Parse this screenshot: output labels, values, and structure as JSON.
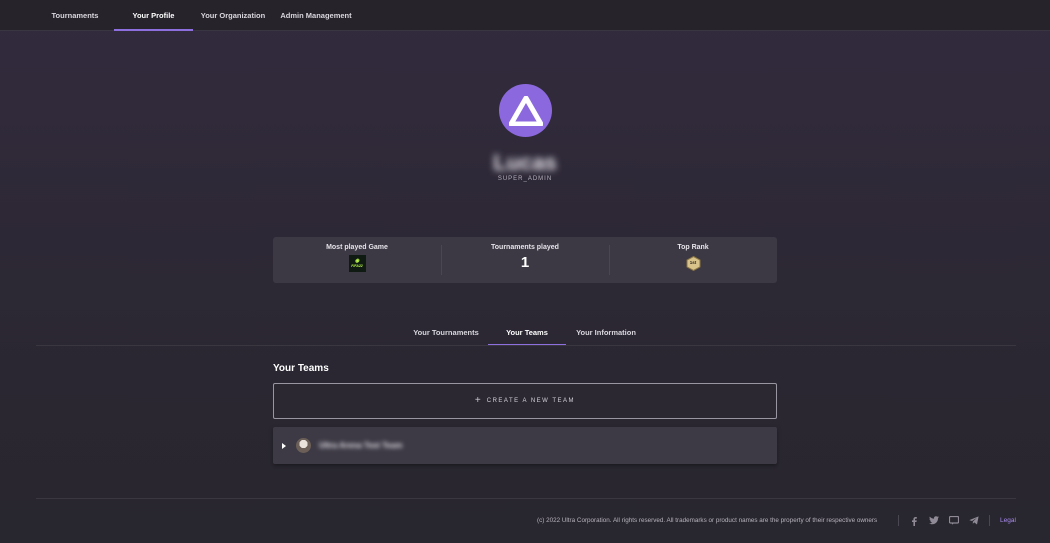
{
  "nav": {
    "items": [
      {
        "label": "Tournaments",
        "active": false
      },
      {
        "label": "Your Profile",
        "active": true
      },
      {
        "label": "Your Organization",
        "active": false
      },
      {
        "label": "Admin Management",
        "active": false
      }
    ]
  },
  "profile": {
    "username": "Lucas",
    "role": "SUPER_ADMIN",
    "avatar_icon": "brand-logo-icon"
  },
  "stats": {
    "most_played_title": "Most played Game",
    "most_played_game": "FIFA22",
    "tournaments_title": "Tournaments played",
    "tournaments_value": "1",
    "top_rank_title": "Top Rank",
    "top_rank_value": "1st"
  },
  "tabs": [
    {
      "label": "Your Tournaments",
      "active": false
    },
    {
      "label": "Your Teams",
      "active": true
    },
    {
      "label": "Your Information",
      "active": false
    }
  ],
  "teams": {
    "title": "Your Teams",
    "create_label": "CREATE A NEW TEAM",
    "items": [
      {
        "name": "Ultra Arena Test Team"
      }
    ]
  },
  "footer": {
    "copyright": "(c) 2022 Ultra Corporation. All rights reserved. All trademarks or product names are the property of their respective owners",
    "legal": "Legal",
    "social": [
      "facebook-icon",
      "twitter-icon",
      "discord-icon",
      "telegram-icon"
    ]
  },
  "colors": {
    "accent": "#8e6fe0",
    "avatar_bg": "#8b68dd",
    "legal_link": "#a98cf0"
  }
}
